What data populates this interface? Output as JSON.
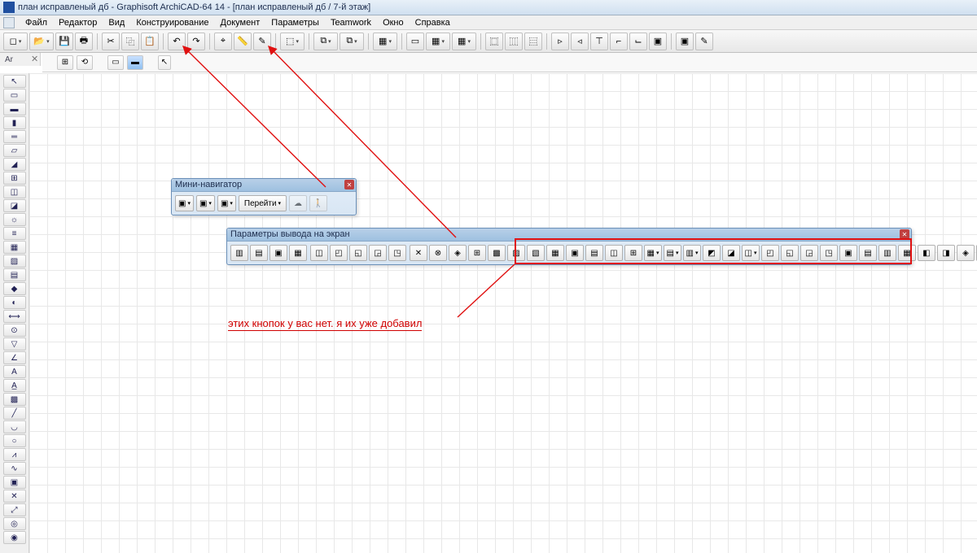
{
  "window": {
    "title": "план исправленый дб - Graphisoft ArchiCAD-64 14 - [план исправленый дб / 7-й этаж]"
  },
  "menu": {
    "items": [
      "Файл",
      "Редактор",
      "Вид",
      "Конструирование",
      "Документ",
      "Параметры",
      "Teamwork",
      "Окно",
      "Справка"
    ]
  },
  "toolbar": {
    "icons": [
      "new",
      "open",
      "save",
      "print",
      "cut",
      "copy",
      "paste",
      "undo",
      "redo",
      "pick",
      "measure",
      "wand",
      "grp-a",
      "grp-b",
      "trace",
      "trace2",
      "grid",
      "layer1",
      "layer2",
      "layer3",
      "view1",
      "view2",
      "tw1",
      "tw2",
      "tw3",
      "tw4",
      "tw5",
      "fav",
      "last"
    ]
  },
  "tabs": {
    "label": "Ar",
    "close": "✕"
  },
  "quickbar": {
    "icons": [
      "ins",
      "rot",
      "mir",
      "arr",
      "rect",
      "ptr"
    ]
  },
  "toolbox": {
    "tools": [
      "sel",
      "wall",
      "col",
      "beam",
      "slab",
      "roof",
      "win",
      "door",
      "obj",
      "lamp",
      "stair",
      "mesh",
      "zone",
      "dim",
      "rad",
      "lvl",
      "ang",
      "text",
      "lbl",
      "fill",
      "line",
      "arc",
      "circ",
      "poly",
      "spl",
      "fig",
      "hot",
      "sec",
      "det",
      "cam"
    ]
  },
  "palette_nav": {
    "title": "Мини-навигатор",
    "go": "Перейти",
    "icons": [
      "a",
      "b",
      "c"
    ]
  },
  "palette_disp": {
    "title": "Параметры вывода на экран",
    "groups": {
      "g1": [
        "opt1",
        "opt2",
        "opt3",
        "opt4"
      ],
      "g2": [
        "opt5",
        "opt6",
        "opt7",
        "opt8",
        "opt9"
      ],
      "g3": [
        "o1",
        "o2",
        "o3",
        "o4",
        "o5",
        "o6",
        "o7",
        "o8"
      ],
      "g4": [
        "n1",
        "n2",
        "n3",
        "n4",
        "n5",
        "n6",
        "n7",
        "n8",
        "n9",
        "n10",
        "n11",
        "n12",
        "n13",
        "n14",
        "n15",
        "n16",
        "n17",
        "n18",
        "n19",
        "n20",
        "n21",
        "n22",
        "n23",
        "n24",
        "n25",
        "n26"
      ]
    }
  },
  "annotation": {
    "text": "этих кнопок у вас нет. я их уже добавил"
  }
}
